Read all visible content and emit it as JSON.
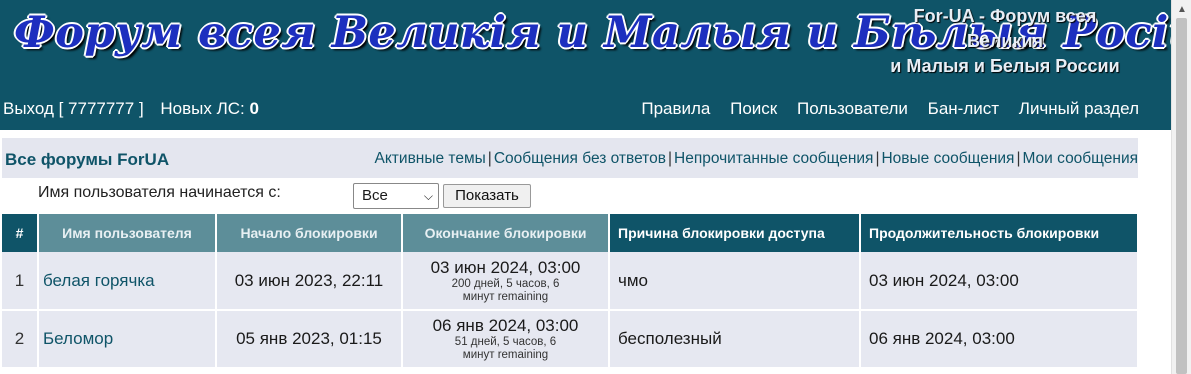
{
  "header": {
    "logo_text": "Форум всея Великія и Малыя и Бѣлыя Росіи",
    "site_tag": [
      "For-UA - Форум всея",
      "Великия",
      "и Малыя и Белыя России"
    ]
  },
  "user_bar": {
    "logout_label": "Выход [ 7777777 ]",
    "new_pm_label": "Новых ЛС:",
    "new_pm_count": "0"
  },
  "top_nav": [
    "Правила",
    "Поиск",
    "Пользователи",
    "Бан-лист",
    "Личный раздел"
  ],
  "forum_bar": {
    "title": "Все форумы ForUA",
    "links": [
      "Активные темы",
      "Сообщения без ответов",
      "Непрочитанные сообщения",
      "Новые сообщения",
      "Мои сообщения"
    ],
    "separator": "|"
  },
  "filter": {
    "label": "Имя пользователя начинается с:",
    "selected": "Все",
    "button": "Показать"
  },
  "table": {
    "columns": [
      "#",
      "Имя пользователя",
      "Начало блокировки",
      "Окончание блокировки",
      "Причина блокировки доступа",
      "Продолжительность блокировки"
    ],
    "rows": [
      {
        "num": "1",
        "name": "белая горячка",
        "start": "03 июн 2023, 22:11",
        "end": "03 июн 2024, 03:00",
        "remaining_1": "200 дней, 5 часов, 6",
        "remaining_2": "минут remaining",
        "reason": "чмо",
        "duration": "03 июн 2024, 03:00"
      },
      {
        "num": "2",
        "name": "Беломор",
        "start": "05 янв 2023, 01:15",
        "end": "06 янв 2024, 03:00",
        "remaining_1": "51 дней, 5 часов, 6",
        "remaining_2": "минут remaining",
        "reason": "бесполезный",
        "duration": "06 янв 2024, 03:00"
      }
    ]
  }
}
